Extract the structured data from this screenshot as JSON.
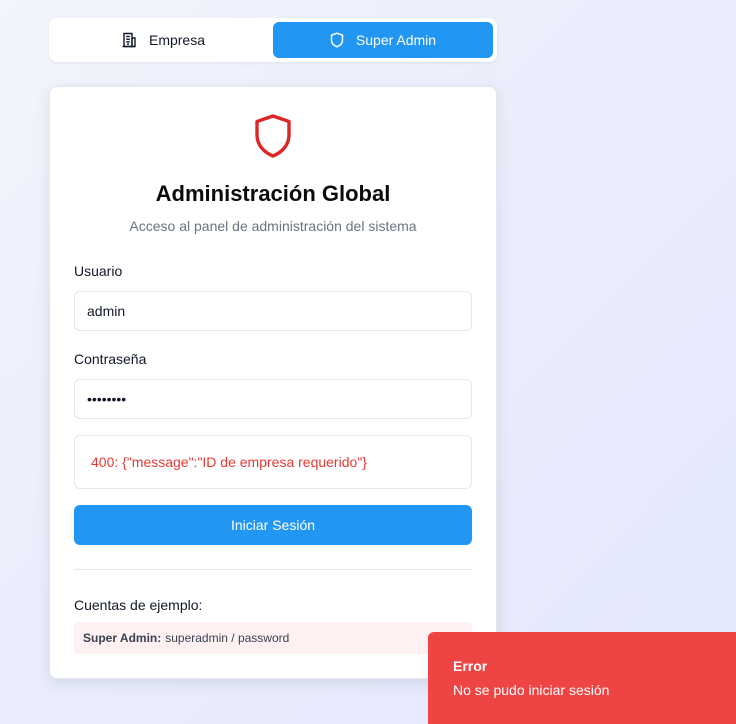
{
  "tabs": [
    {
      "label": "Empresa",
      "icon": "building-icon",
      "active": false
    },
    {
      "label": "Super Admin",
      "icon": "shield-icon",
      "active": true
    }
  ],
  "colors": {
    "accent": "#2196f3",
    "shield": "#dc2626",
    "error_text": "#e53935",
    "toast_bg": "#ef4444",
    "example_bg": "#fff1f1"
  },
  "login": {
    "icon": "shield-icon",
    "title": "Administración Global",
    "subtitle": "Acceso al panel de administración del sistema",
    "username_label": "Usuario",
    "username_value": "admin",
    "password_label": "Contraseña",
    "password_value": "********",
    "error_message": "400: {\"message\":\"ID de empresa requerido\"}",
    "submit_label": "Iniciar Sesión",
    "examples_title": "Cuentas de ejemplo:",
    "example_account": {
      "role": "Super Admin:",
      "credentials": "superadmin / password"
    }
  },
  "toast": {
    "title": "Error",
    "message": "No se pudo iniciar sesión"
  }
}
